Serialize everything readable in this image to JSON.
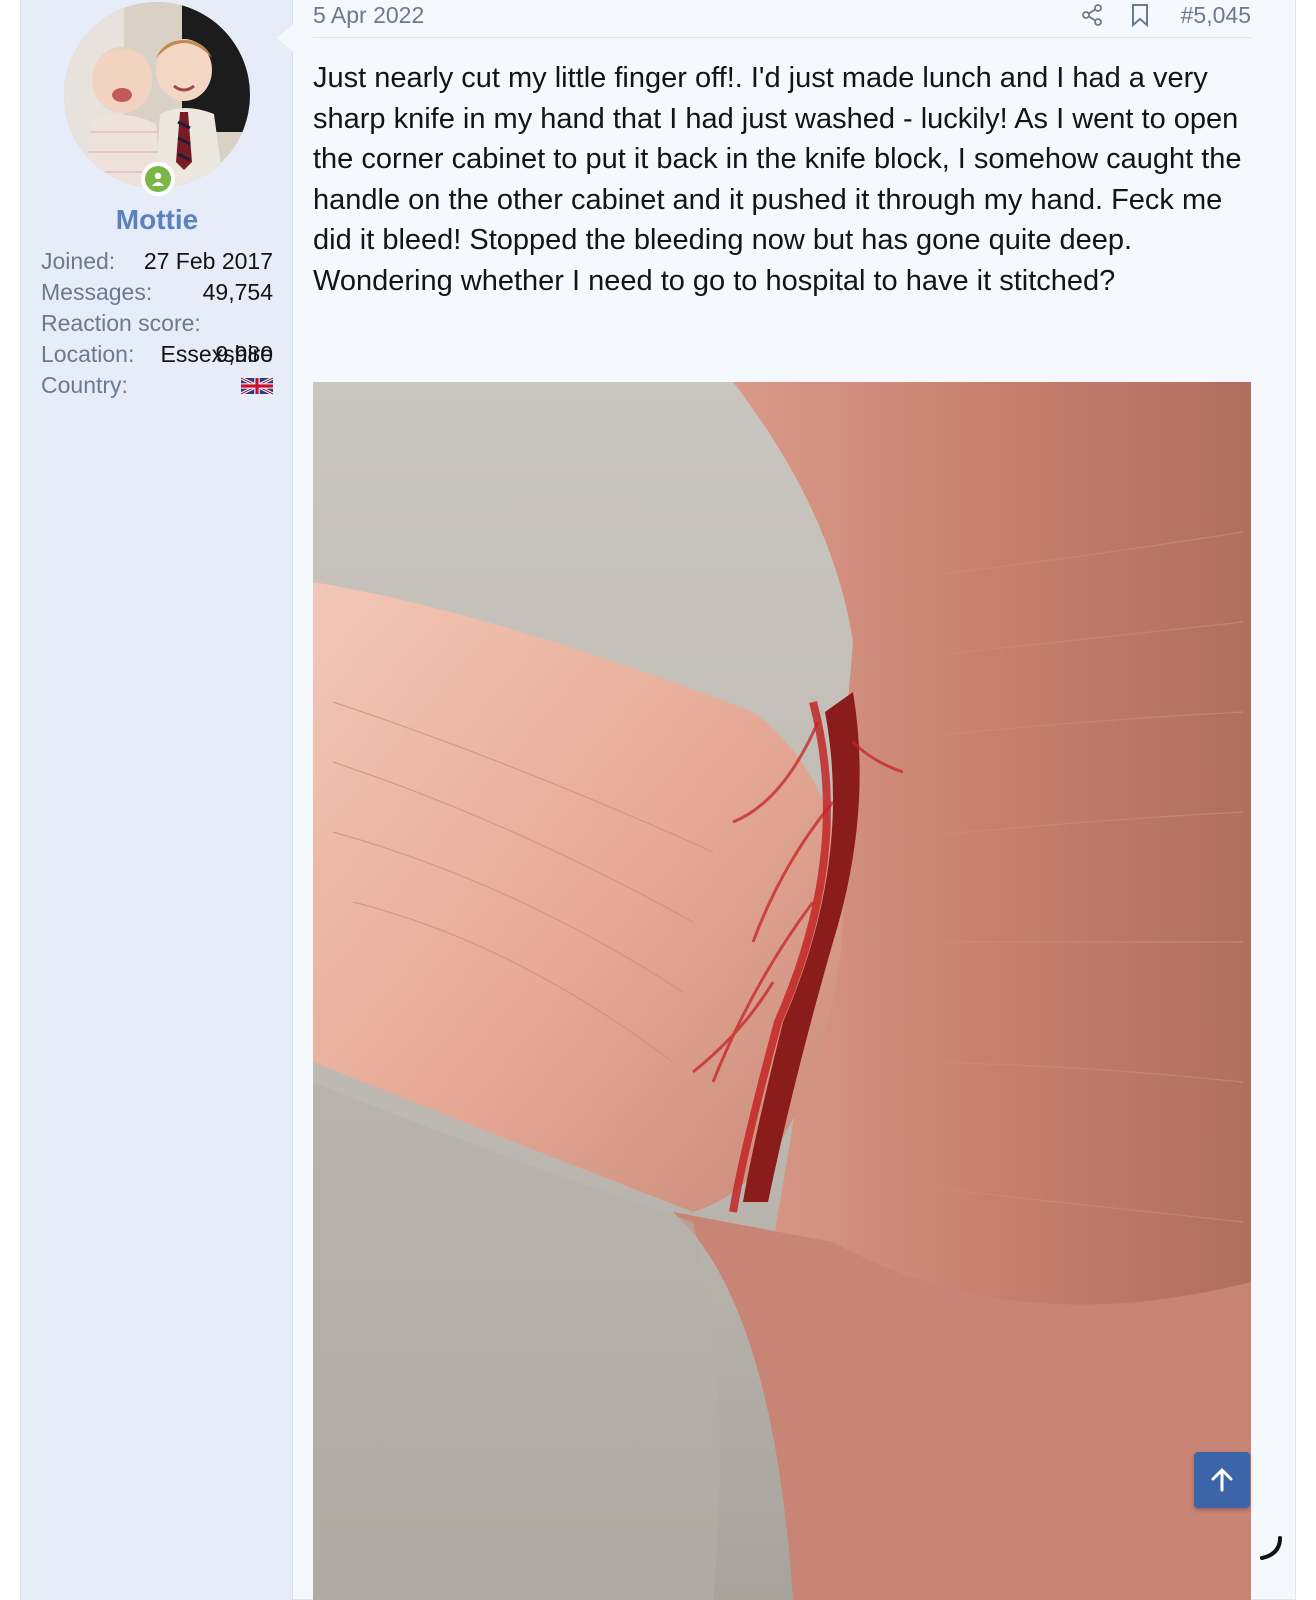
{
  "post": {
    "date": "5 Apr 2022",
    "number": "#5,045",
    "message": "Just nearly cut my little finger off!. I'd just made lunch and I had a very sharp knife in my hand that I had just washed - luckily! As I went to open the corner cabinet to put it back in the knife block, I somehow caught the handle on the other cabinet and it pushed it through my hand. Feck me did it bleed! Stopped the bleeding now but has gone quite deep. Wondering whether I need to go to hospital to have it stitched?",
    "actions": {
      "share_icon": "share-icon",
      "bookmark_icon": "bookmark-icon"
    }
  },
  "user": {
    "name": "Mottie",
    "status_icon": "online-user-icon",
    "stats": {
      "joined_label": "Joined:",
      "joined": "27 Feb 2017",
      "messages_label": "Messages:",
      "messages": "49,754",
      "reaction_label": "Reaction score:",
      "reaction": "9,980",
      "location_label": "Location:",
      "location": "Essexshire",
      "country_label": "Country:",
      "country_flag": "uk-flag-icon"
    }
  },
  "controls": {
    "scroll_top_icon": "arrow-up-icon",
    "loading_icon": "spinner-icon"
  },
  "colors": {
    "accent": "#5b82c0",
    "sidebar_bg": "#e6edf8",
    "online": "#7ab648",
    "scroll_button": "#3c64a8"
  }
}
